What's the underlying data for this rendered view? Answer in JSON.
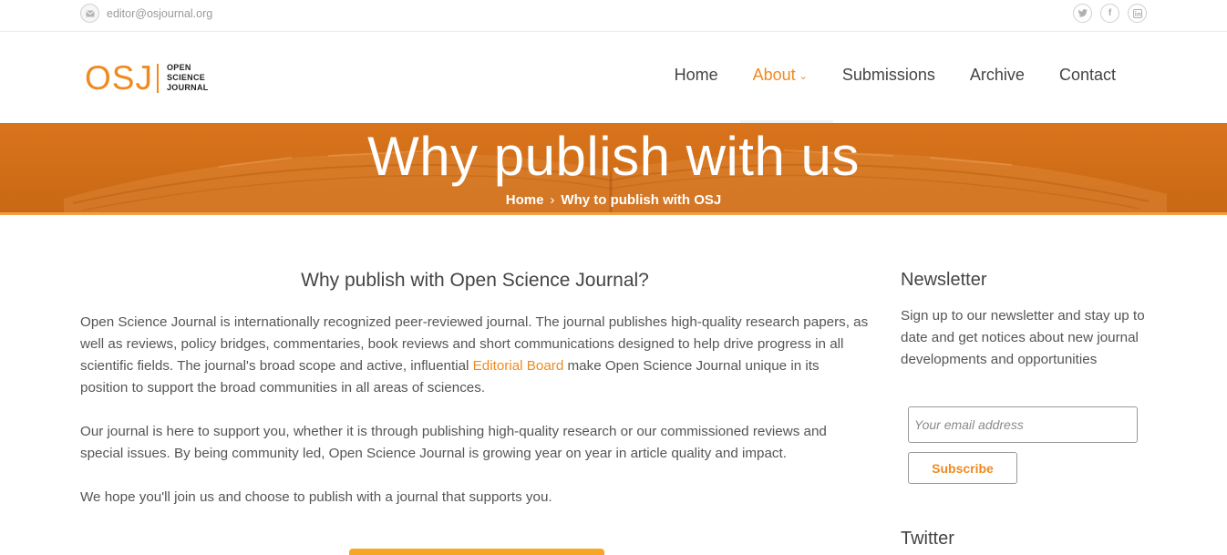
{
  "topbar": {
    "email": "editor@osjournal.org",
    "email_icon": "envelope-icon",
    "social": [
      {
        "icon": "twitter-icon",
        "glyph": "t"
      },
      {
        "icon": "facebook-icon",
        "glyph": "f"
      },
      {
        "icon": "linkedin-icon",
        "glyph": "in"
      }
    ]
  },
  "logo": {
    "mark": "OSJ",
    "line1": "OPEN",
    "line2": "SCIENCE",
    "line3": "JOURNAL"
  },
  "nav": {
    "home": "Home",
    "about": "About",
    "submissions": "Submissions",
    "archive": "Archive",
    "contact": "Contact"
  },
  "banner": {
    "title": "Why publish with us",
    "breadcrumb_home": "Home",
    "breadcrumb_sep": "›",
    "breadcrumb_current": "Why to publish with OSJ"
  },
  "main": {
    "heading": "Why publish with Open Science Journal?",
    "p1_before": "Open Science Journal is internationally recognized peer-reviewed journal. The journal publishes high-quality research papers, as well as reviews, policy bridges, commentaries, book reviews and short communications designed to help drive progress in all scientific fields. The journal's broad scope and active, influential ",
    "p1_link": "Editorial Board",
    "p1_after": " make Open Science Journal unique in its position to support the broad communities in all areas of sciences.",
    "p2": "Our journal is here to support you, whether it is through publishing high-quality research or our commissioned reviews and special issues. By being community led, Open Science Journal is growing year on year in article quality and impact.",
    "p3": "We hope you'll join us and choose to publish with a journal that supports you."
  },
  "sidebar": {
    "newsletter_title": "Newsletter",
    "newsletter_text": "Sign up to our newsletter and stay up to date and get notices about new journal developments and opportunities",
    "email_placeholder": "Your email address",
    "subscribe_label": "Subscribe",
    "twitter_title": "Twitter"
  },
  "colors": {
    "accent": "#ef8a1f",
    "banner": "#d9741c"
  }
}
